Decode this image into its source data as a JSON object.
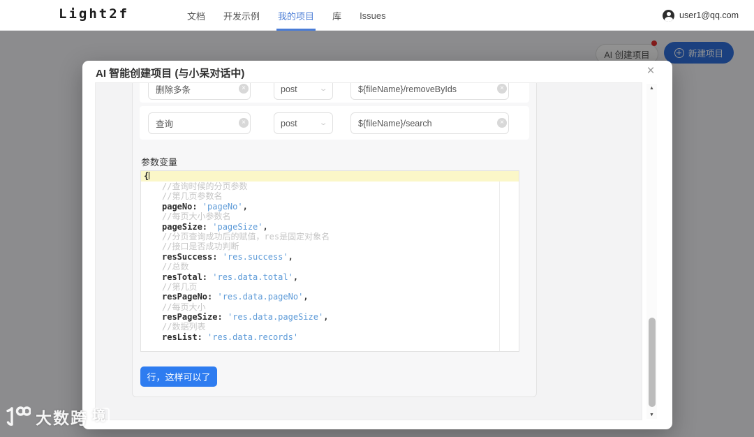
{
  "nav": {
    "logo": "Light2f",
    "items": [
      {
        "label": "文档",
        "active": false
      },
      {
        "label": "开发示例",
        "active": false
      },
      {
        "label": "我的项目",
        "active": true
      },
      {
        "label": "库",
        "active": false
      },
      {
        "label": "Issues",
        "active": false
      }
    ],
    "user_email": "user1@qq.com"
  },
  "background_page": {
    "ai_create_button": "AI 创建项目",
    "new_project_button": "新建项目"
  },
  "modal": {
    "title": "AI 智能创建项目 (与小呆对话中)",
    "close_icon": "×",
    "rows": [
      {
        "tag": "删除多条",
        "method": "post",
        "url": "${fileName}/removeByIds"
      },
      {
        "tag": "查询",
        "method": "post",
        "url": "${fileName}/search"
      }
    ],
    "params_label": "参数变量",
    "code": {
      "open_brace": "{",
      "lines": [
        {
          "type": "comment",
          "text": "//查询时候的分页参数"
        },
        {
          "type": "comment",
          "text": "//第几页参数名"
        },
        {
          "type": "pair",
          "key": "pageNo",
          "value": "'pageNo'",
          "comma": true
        },
        {
          "type": "comment",
          "text": "//每页大小参数名"
        },
        {
          "type": "pair",
          "key": "pageSize",
          "value": "'pageSize'",
          "comma": true
        },
        {
          "type": "comment",
          "text": "//分页查询成功后的赋值，res是固定对象名"
        },
        {
          "type": "comment",
          "text": "//接口是否成功判断"
        },
        {
          "type": "pair",
          "key": "resSuccess",
          "value": "'res.success'",
          "comma": true
        },
        {
          "type": "comment",
          "text": "//总数"
        },
        {
          "type": "pair",
          "key": "resTotal",
          "value": "'res.data.total'",
          "comma": true
        },
        {
          "type": "comment",
          "text": "//第几页"
        },
        {
          "type": "pair",
          "key": "resPageNo",
          "value": "'res.data.pageNo'",
          "comma": true
        },
        {
          "type": "comment",
          "text": "//每页大小"
        },
        {
          "type": "pair",
          "key": "resPageSize",
          "value": "'res.data.pageSize'",
          "comma": true
        },
        {
          "type": "comment",
          "text": "//数据列表"
        },
        {
          "type": "pair",
          "key": "resList",
          "value": "'res.data.records'",
          "comma": false
        }
      ]
    },
    "confirm_button": "行，这样可以了"
  },
  "watermark": {
    "text_main": "大数跨",
    "text_boxed": "境"
  },
  "icons": {
    "clear": "×",
    "chevron": "⌄",
    "scroll_up": "▲",
    "scroll_down": "▼"
  },
  "colors": {
    "accent_blue": "#2e7cf0",
    "nav_active_blue": "#4a7cd6",
    "dimmed_new_project_blue": "#2f6fdb",
    "badge_red": "#e02f2f",
    "code_string_blue": "#5e9bd8",
    "code_comment_gray": "#c6c6c6",
    "active_line_yellow": "#fbf7c8"
  }
}
